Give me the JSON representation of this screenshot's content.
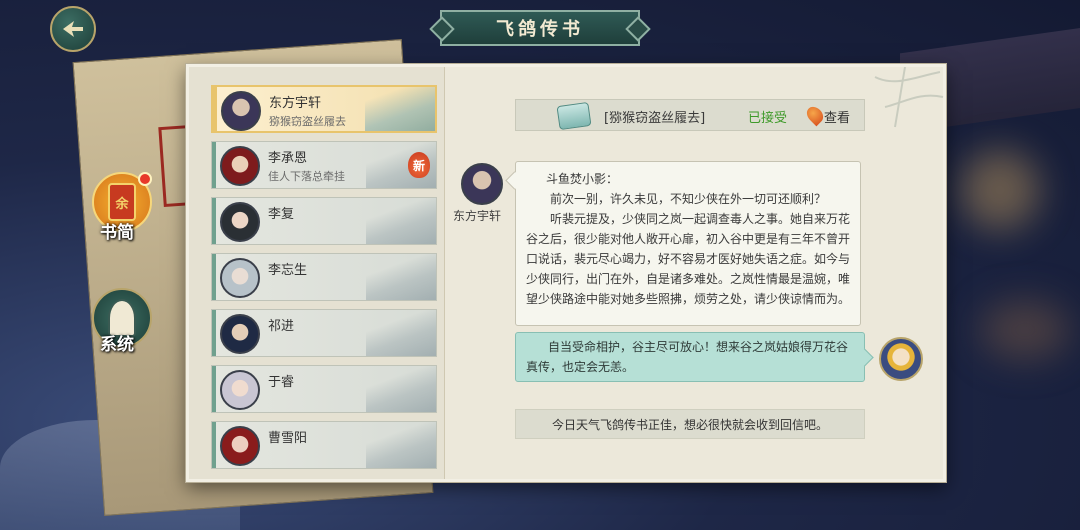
{
  "header": {
    "title": "飞鸽传书"
  },
  "side_tabs": [
    {
      "label": "书简",
      "emblem": "余"
    },
    {
      "label": "系统"
    }
  ],
  "contacts": [
    {
      "name": "东方宇轩",
      "subtitle": "猕猴窃盗丝履去",
      "selected": true
    },
    {
      "name": "李承恩",
      "subtitle": "佳人下落总牵挂",
      "badge": "新"
    },
    {
      "name": "李复",
      "subtitle": ""
    },
    {
      "name": "李忘生",
      "subtitle": ""
    },
    {
      "name": "祁进",
      "subtitle": ""
    },
    {
      "name": "于睿",
      "subtitle": ""
    },
    {
      "name": "曹雪阳",
      "subtitle": ""
    }
  ],
  "quest": {
    "title": "[猕猴窃盗丝履去]",
    "status": "已接受",
    "status_color": "#3e9a2a",
    "view_label": "查看"
  },
  "letter": {
    "sender": "东方宇轩",
    "greeting": "斗鱼焚小影：",
    "paragraphs": [
      "前次一别，许久未见，不知少侠在外一切可还顺利？",
      "听裴元提及，少侠同之岚一起调查毒人之事。她自来万花谷之后，很少能对他人敞开心扉，初入谷中更是有三年不曾开口说话，裴元尽心竭力，好不容易才医好她失语之症。如今与少侠同行，出门在外，自是诸多难处。之岚性情最是温婉，唯望少侠路途中能对她多些照拂，烦劳之处，请少侠谅情而为。"
    ]
  },
  "reply": {
    "text": "自当受命相护，谷主尽可放心！想来谷之岚姑娘得万花谷真传，也定会无恙。"
  },
  "footer": {
    "status_text": "今日天气飞鸽传书正佳，想必很快就会收到回信吧。"
  }
}
